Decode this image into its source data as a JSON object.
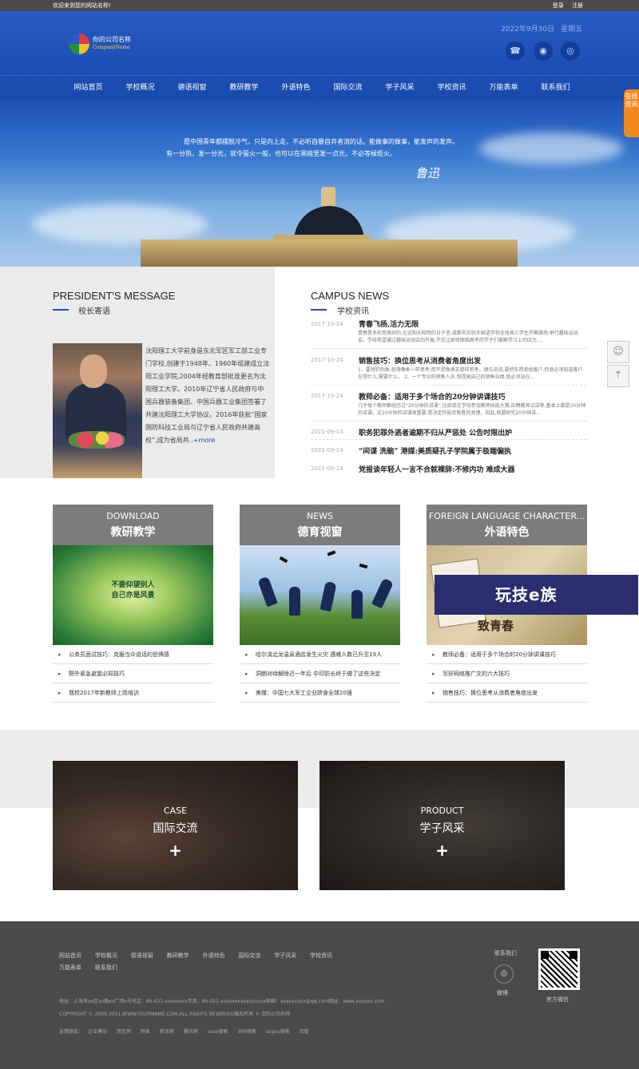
{
  "topbar": {
    "welcome": "欢迎来到您的网站名称!",
    "login": "登录",
    "register": "注册"
  },
  "header": {
    "logo_name": "你的公司名称",
    "logo_sub": "CompanyName",
    "date": "2022年9月30日",
    "weekday": "星期五",
    "icons": [
      "phone-icon",
      "wechat-icon",
      "weibo-icon"
    ]
  },
  "nav": [
    "网站首页",
    "学校概况",
    "德语视窗",
    "教研教学",
    "外语特色",
    "国际交流",
    "学子风采",
    "学校资讯",
    "万能表单",
    "联系我们"
  ],
  "banner": {
    "quote_line1": "愿中国青年都摆脱冷气，只是向上走，不必听自暴自弃者流的话。能做事的做事，能发声的发声。",
    "quote_line2": "有一分热，发一分光，就令萤火一般，也可以在黑暗里发一点光，不必等候炬火。",
    "signature": "鲁迅",
    "consult": "在线咨询"
  },
  "president": {
    "title_en": "PRESIDENT'S MESSAGE",
    "title_cn": "校长寄语",
    "text": "沈阳理工大学前身是东北军区军工部工业专门学校,创建于1948年。1960年组建成立沈阳工业学院,2004年经教育部批准更名为沈阳理工大学。2010年辽宁省人民政府与中国兵器装备集团、中国兵器工业集团签署了共建沈阳理工大学协议。2016年获批“国家国防科技工业局与辽宁省人民政府共建高校”,成为省局共..",
    "more": "+more"
  },
  "campus_news": {
    "title_en": "CAMPUS NEWS",
    "title_cn": "学校资讯",
    "items": [
      {
        "date": "2017-10-24",
        "title": "青春飞扬,活力无限",
        "desc": "青春是多彩而美好的,在这阳光和煦的日子里,成都市实验外国语学校全体高三学生齐聚操场,举行趣味运动会。学校希望通过趣味运动会的开展,不仅让即将面临高考的学子们缓解学习上的压力,..."
      },
      {
        "date": "2017-10-24",
        "title": "销售技巧：换位思考从消费者角度出发",
        "desc": "1、要想钓到鱼,就得像鱼一样思考,而不是像渔夫那样思考。换位说说,要把东西卖给客户,你就必须知道客户在想什么,需要什么。 2、一个专业的销售人员,想提高自己的销售业绩,就必须站在..."
      },
      {
        "date": "2017-10-24",
        "title": "教师必备：适用于多个场合的20分钟讲课技巧",
        "desc": "几乎每个教师都经历过“20分钟的讲课”,比如说在学校参加教师技能大赛,应聘教师试讲等,基本上都是20分钟的讲课。这20分钟的讲课很重要,是决定你能否制胜的关键。因此,就要研究20分钟讲..."
      },
      {
        "date": "2021-09-14",
        "title": "职务犯罪外逃者逾期不归从严惩处 公告时限出炉",
        "desc": ""
      },
      {
        "date": "2021-09-14",
        "title": "“间谍 洗脑” 港媒:美质疑孔子学院属于极端偏执",
        "desc": ""
      },
      {
        "date": "2021-09-14",
        "title": "党报谈年轻人一言不合就裸辞:不修内功 难成大器",
        "desc": ""
      }
    ]
  },
  "cards": [
    {
      "en": "DOWNLOAD",
      "cn": "教研教学",
      "img_text": "不要仰望别人\n自己亦是风景",
      "items": [
        "公务员面试技巧：克服当众说话的恐惧感",
        "野外紧急避震必知技巧",
        "我校2017年新教师上岗培训"
      ]
    },
    {
      "en": "NEWS",
      "cn": "德育视窗",
      "img_text": "",
      "items": [
        "哈尔滨北龙温泉酒店发生火灾 遇难人数已升至19人",
        "洞朗对峙解除近一年后 中印防长终于做了这些决定",
        "美媒：中国七大军工企业跻身全球20强"
      ]
    },
    {
      "en": "FOREIGN LANGUAGE CHARACTER...",
      "cn": "外语特色",
      "img_text": "致青春",
      "items": [
        "教师必备：适用于多个场合的20分钟讲课技巧",
        "写好网络推广文的六大技巧",
        "销售技巧：换位思考从消费者角度出发"
      ]
    }
  ],
  "ad": {
    "text": "玩技e族"
  },
  "big_tiles": [
    {
      "en": "CASE",
      "cn": "国际交流",
      "plus": "+"
    },
    {
      "en": "PRODUCT",
      "cn": "学子风采",
      "plus": "+"
    }
  ],
  "footer": {
    "nav": [
      "网站首页",
      "学校概况",
      "德语视窗",
      "教研教学",
      "外语特色",
      "国际交流",
      "学子风采",
      "学校资讯",
      "万能表单",
      "联系我们"
    ],
    "address": "地址：上海市xx区xx路xx广场x号电话：86-021-xxxxxxxx传真：86-021-xxxxxxxxxxxxxxxx邮箱：xxxxxxxxx@qq.com网址：www.xxxxxx.com",
    "copyright": "COPYRIGHT © 2009-2011,WWW.YOURNAME.COM,ALL RIGHTS RESERVED版权所有 © 您的公司名称",
    "links_label": "友情链接：",
    "links": [
      "企业建站",
      "淘宝网",
      "网易",
      "新浪网",
      "腾讯网",
      "soso搜索",
      "360搜索",
      "sogou搜索",
      "百度"
    ],
    "contact_label": "联系我们",
    "weibo_label": "微博",
    "wechat_label": "官方微信"
  }
}
